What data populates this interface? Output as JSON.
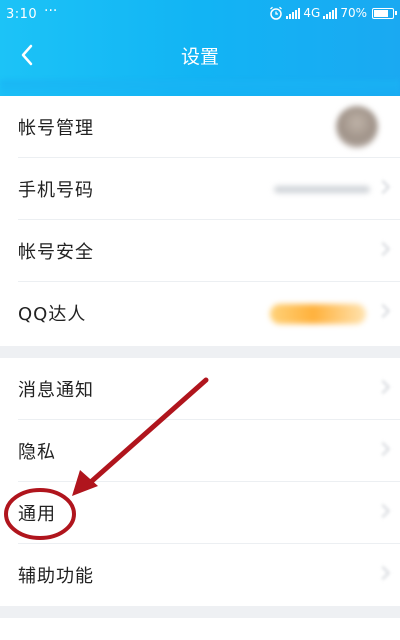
{
  "status_bar": {
    "time": "3:10",
    "notif_dots": "···",
    "network_type": "4G",
    "battery_text": "70%"
  },
  "header": {
    "title": "设置",
    "back_icon": "chevron-left-icon"
  },
  "settings": {
    "group1": [
      {
        "label": "帐号管理",
        "trailing": "avatar"
      },
      {
        "label": "手机号码",
        "trailing": "blurred-text"
      },
      {
        "label": "帐号安全",
        "trailing": "chevron"
      },
      {
        "label": "QQ达人",
        "trailing": "badge"
      }
    ],
    "group2": [
      {
        "label": "消息通知"
      },
      {
        "label": "隐私"
      },
      {
        "label": "通用"
      },
      {
        "label": "辅助功能"
      }
    ]
  },
  "annotation": {
    "circled_item": "通用",
    "color": "#b0151d"
  },
  "colors": {
    "header_gradient_start": "#1cc3f7",
    "header_gradient_end": "#1aa9f2",
    "background": "#eef0f3",
    "annotation_red": "#b0151d"
  }
}
